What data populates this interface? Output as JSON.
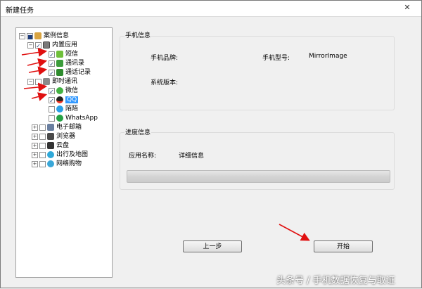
{
  "window": {
    "title": "新建任务",
    "close_icon": "close-icon"
  },
  "tree": {
    "root": "案例信息",
    "builtin_apps": "内置应用",
    "sms": "短信",
    "contacts": "通讯录",
    "call_log": "通话记录",
    "im": "即时通讯",
    "wechat": "微信",
    "qq": "QQ",
    "momo": "陌陌",
    "whatsapp": "WhatsApp",
    "email": "电子邮箱",
    "browser": "浏览器",
    "cloud": "云盘",
    "travel": "出行及地图",
    "shopping": "网络购物"
  },
  "phone_info": {
    "legend": "手机信息",
    "brand_label": "手机品牌:",
    "model_label": "手机型号:",
    "model_value": "MirrorImage",
    "os_label": "系统版本:"
  },
  "progress_info": {
    "legend": "进度信息",
    "app_name_label": "应用名称:",
    "detail_label": "详细信息",
    "progress_fraction": 0
  },
  "buttons": {
    "prev": "上一步",
    "start": "开始"
  },
  "watermark": "头条号 / 手机数据恢复与取证",
  "colors": {
    "arrow": "#e01010",
    "selection": "#3399ff"
  }
}
